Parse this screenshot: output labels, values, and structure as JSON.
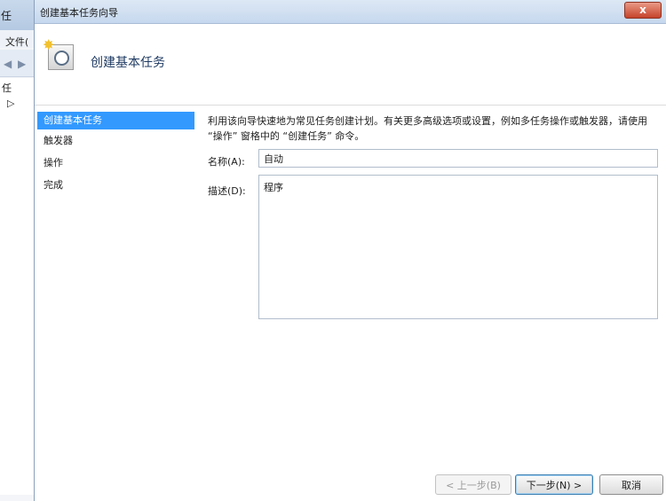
{
  "parent_window": {
    "title": "任",
    "menu_file": "文件(",
    "tree_root": "任",
    "tree_child": "▷"
  },
  "dialog": {
    "title": "创建基本任务向导",
    "close_label": "x",
    "header_title": "创建基本任务"
  },
  "steps": [
    {
      "label": "创建基本任务",
      "selected": true
    },
    {
      "label": "触发器",
      "selected": false
    },
    {
      "label": "操作",
      "selected": false
    },
    {
      "label": "完成",
      "selected": false
    }
  ],
  "form": {
    "description": "利用该向导快速地为常见任务创建计划。有关更多高级选项或设置，例如多任务操作或触发器，请使用 “操作” 窗格中的 “创建任务” 命令。",
    "name_label": "名称(A):",
    "name_value": "自动",
    "desc_label": "描述(D):",
    "desc_value": "程序"
  },
  "buttons": {
    "back": "< 上一步(B)",
    "next": "下一步(N) >",
    "cancel": "取消"
  }
}
